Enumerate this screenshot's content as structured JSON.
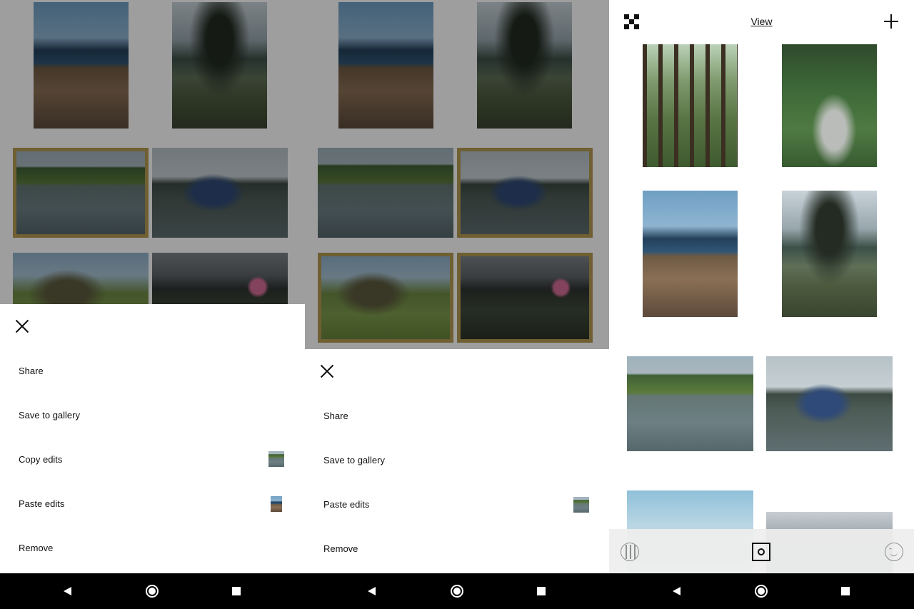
{
  "panel_1": {
    "sheet": {
      "items": [
        {
          "label": "Share"
        },
        {
          "label": "Save to gallery"
        },
        {
          "label": "Copy edits"
        },
        {
          "label": "Paste edits"
        },
        {
          "label": "Remove"
        }
      ]
    }
  },
  "panel_2": {
    "sheet": {
      "items": [
        {
          "label": "Share"
        },
        {
          "label": "Save to gallery"
        },
        {
          "label": "Paste edits"
        },
        {
          "label": "Remove"
        }
      ]
    }
  },
  "panel_3": {
    "header": {
      "logo_icon": "vsco-logo-icon",
      "view_label": "View",
      "add_icon": "plus-icon"
    },
    "tabs": [
      "feed-tab-icon",
      "studio-tab-icon",
      "profile-tab-icon"
    ]
  },
  "navbar": {
    "icons": [
      "back-icon",
      "home-icon",
      "recents-icon"
    ]
  },
  "colors": {
    "selection_border": "#b39a52",
    "navbar": "#000000",
    "tab_bar": "#eeeeee"
  }
}
